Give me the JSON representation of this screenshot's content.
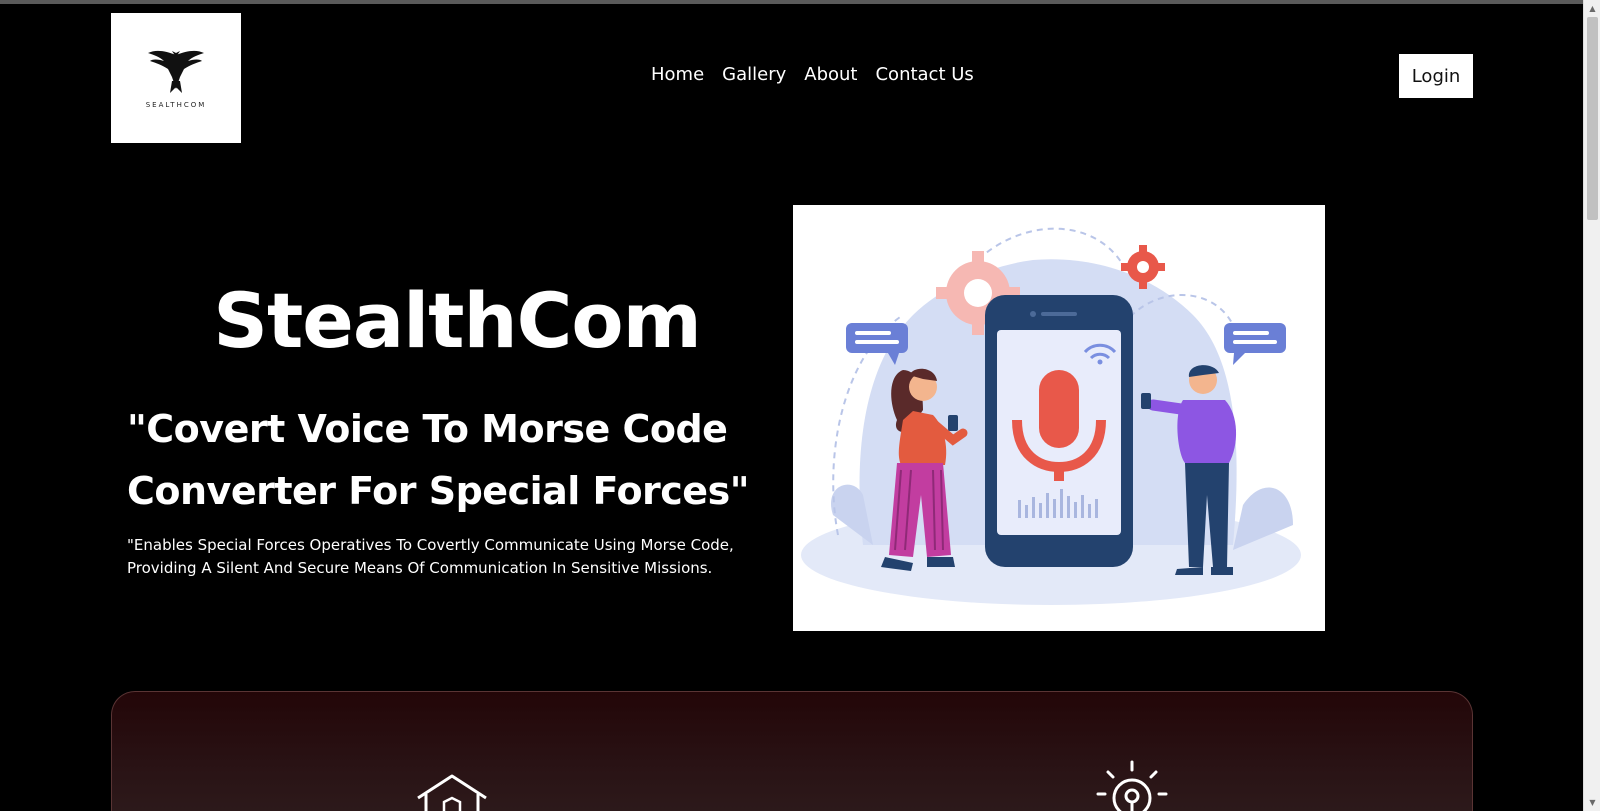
{
  "logo": {
    "text": "SEALTHCOM",
    "icon": "eagle-icon"
  },
  "nav": {
    "items": [
      "Home",
      "Gallery",
      "About",
      "Contact Us"
    ]
  },
  "header": {
    "login_label": "Login"
  },
  "hero": {
    "title": "StealthCom",
    "subtitle_line1": "\"Covert Voice To Morse Code",
    "subtitle_line2": "Converter For Special Forces\"",
    "description_line1": "\"Enables Special Forces Operatives To Covertly Communicate Using Morse Code,",
    "description_line2": "Providing A Silent And Secure Means Of Communication In Sensitive Missions.",
    "image": "voice-communication-illustration"
  },
  "features": {
    "icons": [
      "secure-home-icon",
      "idea-bulb-icon"
    ]
  },
  "colors": {
    "background": "#000000",
    "panel_gradient_top": "#230608",
    "panel_gradient_bottom": "#2e1c1d",
    "mic_red": "#e8584a",
    "phone_navy": "#23426e",
    "purple": "#8d56e3",
    "pink": "#c23da0"
  }
}
